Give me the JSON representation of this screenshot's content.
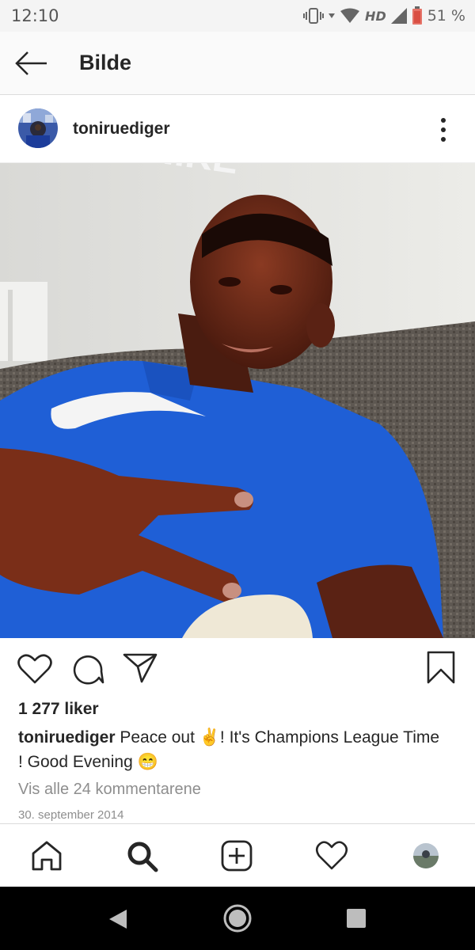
{
  "status_bar": {
    "time": "12:10",
    "network": "HD",
    "battery": "51 %"
  },
  "top_bar": {
    "title": "Bilde"
  },
  "post": {
    "username": "toniruediger",
    "likes": "1 277 liker",
    "caption_user": "toniruediger",
    "caption_text": "Peace out ✌️! It's Champions League Time ! Good Evening 😁",
    "view_comments": "Vis alle 24 kommentarene",
    "date": "30. september 2014",
    "image_description_icon": "selfie-photo",
    "shirt_logo_text": "NIKE"
  },
  "bottom_nav": {
    "items": [
      "home-icon",
      "search-icon",
      "add-post-icon",
      "activity-heart-icon",
      "profile-avatar"
    ],
    "active": "search-icon"
  },
  "android_nav": {
    "items": [
      "back-triangle-icon",
      "home-circle-icon",
      "recents-square-icon"
    ]
  },
  "colors": {
    "shirt_blue": "#1f5fd6",
    "text_primary": "#262626",
    "text_secondary": "#8e8e8e"
  }
}
